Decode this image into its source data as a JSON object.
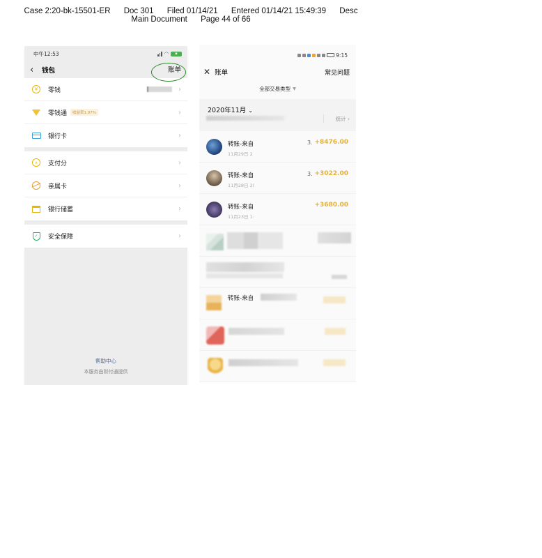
{
  "court_header": {
    "case": "Case 2:20-bk-15501-ER",
    "doc": "Doc 301",
    "filed": "Filed 01/14/21",
    "entered": "Entered 01/14/21 15:49:39",
    "desc": "Desc",
    "main_document": "Main Document",
    "page": "Page 44 of 66"
  },
  "left_phone": {
    "status_time": "中午12:53",
    "nav": {
      "back_icon": "back-arrow-icon",
      "title": "钱包",
      "bill_label": "账单"
    },
    "group1": [
      {
        "label": "零钱",
        "icon": "coin-icon"
      },
      {
        "label": "零钱通",
        "icon": "gem-icon",
        "badge": "收益率1.97%"
      },
      {
        "label": "银行卡",
        "icon": "bank-card-icon"
      }
    ],
    "group2": [
      {
        "label": "支付分",
        "icon": "score-icon"
      },
      {
        "label": "亲属卡",
        "icon": "family-card-icon"
      },
      {
        "label": "银行储蓄",
        "icon": "savings-icon"
      }
    ],
    "group3": [
      {
        "label": "安全保障",
        "icon": "shield-icon"
      }
    ],
    "help_center": "帮助中心",
    "provider_note": "本服务由财付通提供"
  },
  "right_phone": {
    "status_time": "9:15",
    "nav": {
      "close_icon": "close-icon",
      "title": "账单",
      "faq": "常见问题"
    },
    "filter_label": "全部交易类型",
    "month": "2020年11月",
    "stat_label": "统计",
    "transactions": [
      {
        "name": "转账-来自",
        "date": "11月29日 2",
        "mid": "3.",
        "amount": "+8476.00"
      },
      {
        "name": "转账-来自",
        "date": "11月28日 2(",
        "mid": "3.",
        "amount": "+3022.00"
      },
      {
        "name": "转账-来自",
        "date": "11月23日 1:",
        "mid": "",
        "amount": "+3680.00"
      }
    ],
    "partial_transaction_name": "转账-来自"
  },
  "colors": {
    "amount_gold": "#e3b23c",
    "circle_annotation": "#2e8b2e",
    "link_blue": "#576b95"
  }
}
